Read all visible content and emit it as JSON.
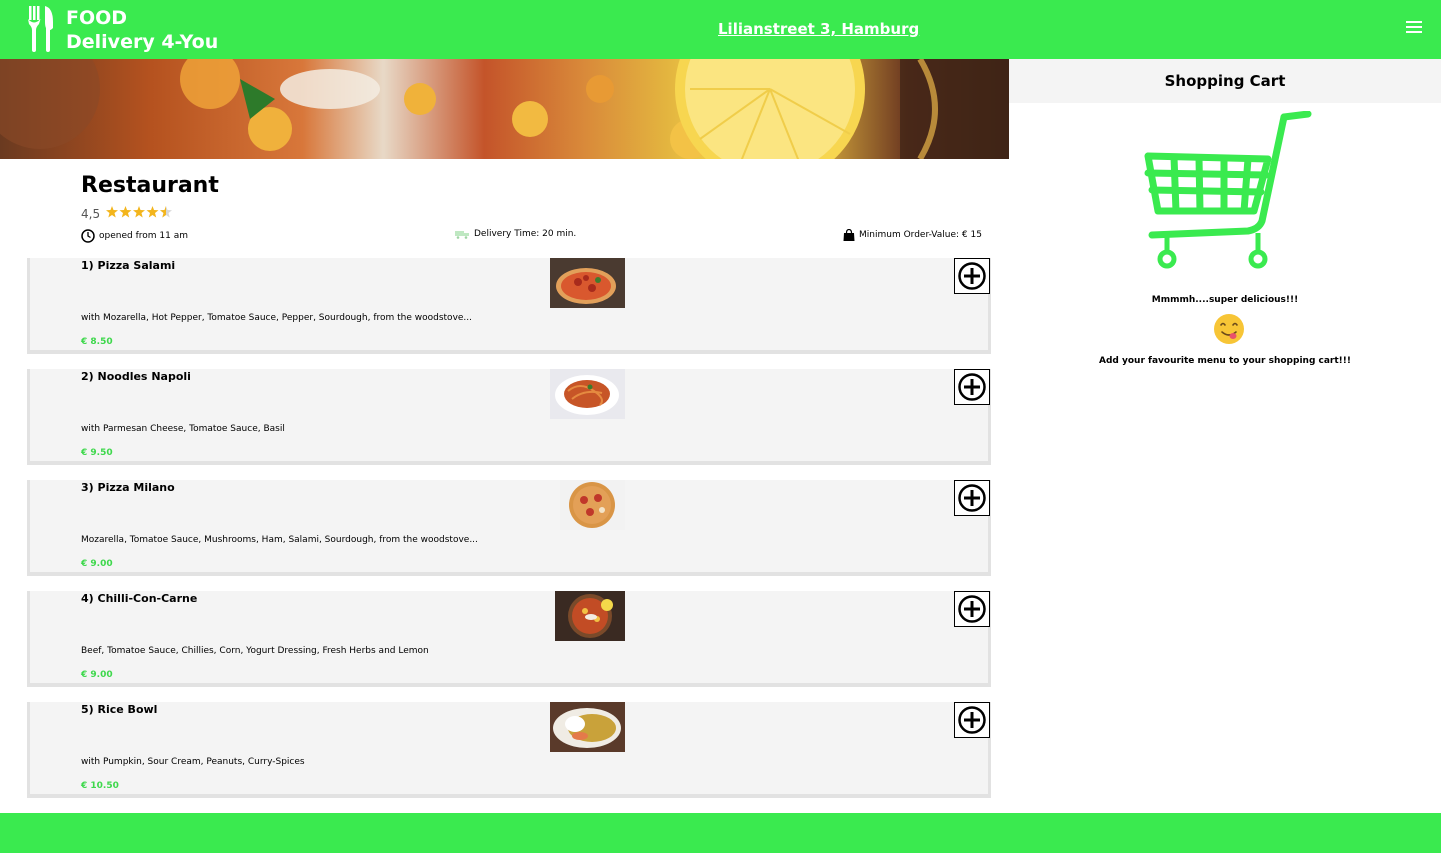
{
  "header": {
    "brand_line1": "FOOD",
    "brand_line2": "Delivery 4-You",
    "address": "Lilianstreet 3, Hamburg"
  },
  "restaurant": {
    "name": "Restaurant",
    "rating": "4,5",
    "stars": 4.5,
    "opened": "opened from 11 am",
    "delivery_time": "Delivery Time: 20 min.",
    "min_order": "Minimum Order-Value: € 15"
  },
  "menu": [
    {
      "name": "1) Pizza Salami",
      "desc": "with Mozarella, Hot Pepper, Tomatoe Sauce, Pepper, Sourdough, from the woodstove...",
      "price": "€ 8.50"
    },
    {
      "name": "2) Noodles Napoli",
      "desc": "with Parmesan Cheese, Tomatoe Sauce, Basil",
      "price": "€ 9.50"
    },
    {
      "name": "3) Pizza Milano",
      "desc": "Mozarella, Tomatoe Sauce, Mushrooms, Ham, Salami, Sourdough, from the woodstove...",
      "price": "€ 9.00"
    },
    {
      "name": "4) Chilli-Con-Carne",
      "desc": "Beef, Tomatoe Sauce, Chillies, Corn, Yogurt Dressing, Fresh Herbs and Lemon",
      "price": "€ 9.00"
    },
    {
      "name": "5) Rice Bowl",
      "desc": "with Pumpkin, Sour Cream, Peanuts, Curry-Spices",
      "price": "€ 10.50"
    }
  ],
  "cart": {
    "title": "Shopping Cart",
    "msg1": "Mmmmh....super delicious!!!",
    "msg2": "Add your favourite menu to your shopping cart!!!"
  },
  "colors": {
    "brand_green": "#3aea4f",
    "price_green": "#3ed84c",
    "star": "#f3b51c"
  },
  "icons": {
    "logo": "fork-knife-icon",
    "menu": "hamburger-menu-icon",
    "add": "plus-circle-icon",
    "clock": "clock-icon",
    "delivery": "delivery-truck-icon",
    "bag": "shopping-bag-icon",
    "cart": "shopping-cart-icon",
    "emoji": "yum-face-emoji"
  }
}
